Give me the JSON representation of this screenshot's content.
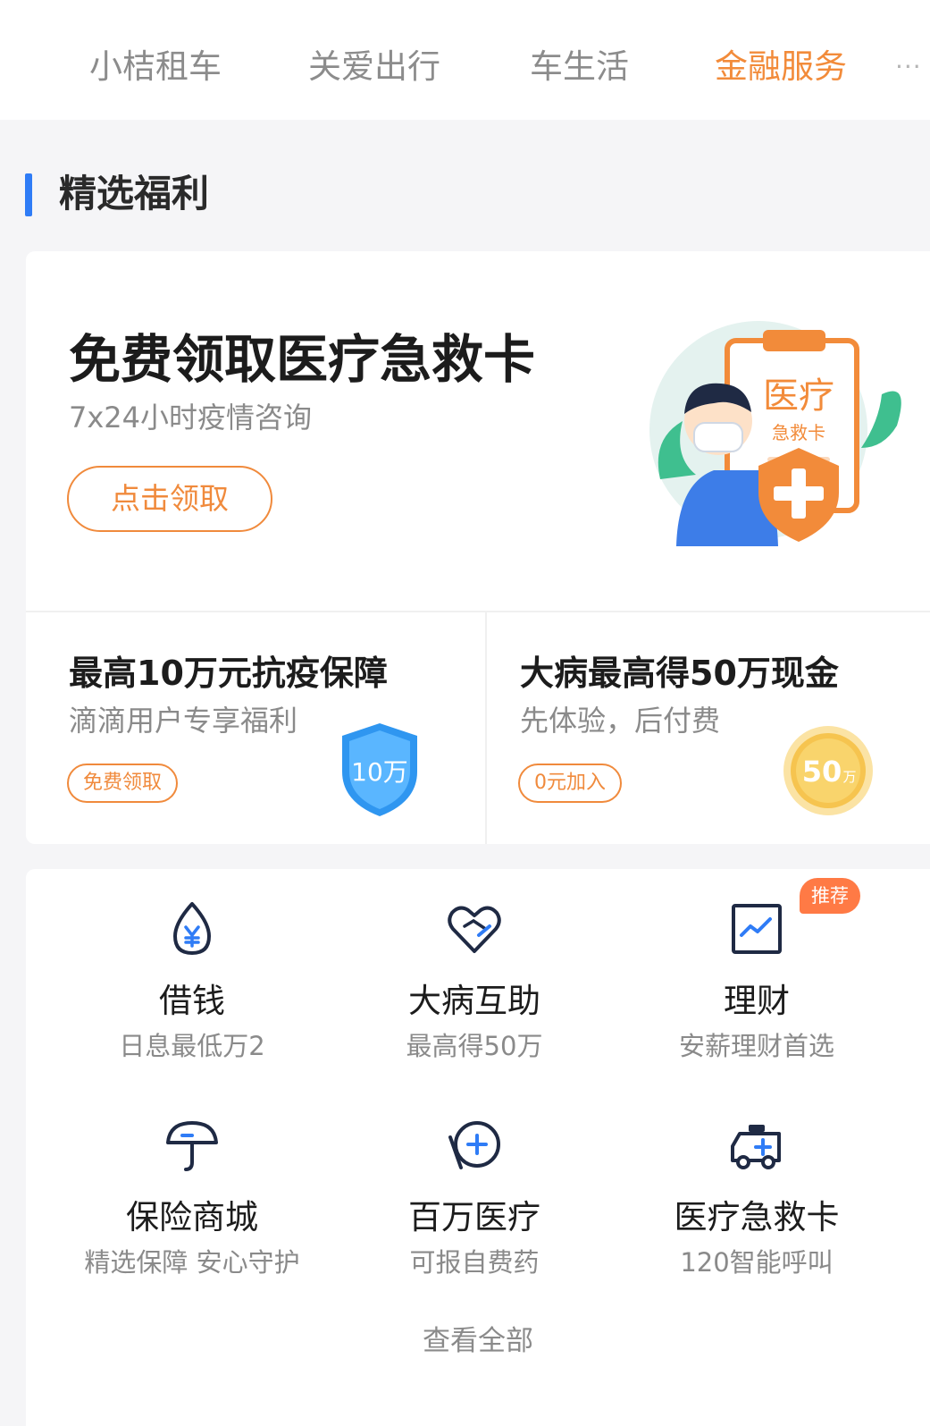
{
  "tabs": [
    {
      "label": "小桔租车",
      "active": false
    },
    {
      "label": "关爱出行",
      "active": false
    },
    {
      "label": "车生活",
      "active": false
    },
    {
      "label": "金融服务",
      "active": true
    }
  ],
  "tabs_more": "···",
  "section": {
    "title": "精选福利"
  },
  "hero": {
    "title": "免费领取医疗急救卡",
    "subtitle": "7x24小时疫情咨询",
    "button": "点击领取",
    "illustration_text_main": "医疗",
    "illustration_text_sub": "急救卡"
  },
  "promos": [
    {
      "title": "最高10万元抗疫保障",
      "subtitle": "滴滴用户专享福利",
      "button": "免费领取",
      "badge": "10万"
    },
    {
      "title": "大病最高得50万现金",
      "subtitle": "先体验，后付费",
      "button": "0元加入",
      "badge_num": "50",
      "badge_unit": "万"
    }
  ],
  "services": [
    {
      "title": "借钱",
      "subtitle": "日息最低万2",
      "icon": "yuan-drop-icon"
    },
    {
      "title": "大病互助",
      "subtitle": "最高得50万",
      "icon": "heart-handshake-icon"
    },
    {
      "title": "理财",
      "subtitle": "安薪理财首选",
      "icon": "chart-up-icon"
    },
    {
      "title": "保险商城",
      "subtitle": "精选保障 安心守护",
      "icon": "umbrella-icon"
    },
    {
      "title": "百万医疗",
      "subtitle": "可报自费药",
      "icon": "medical-shield-icon"
    },
    {
      "title": "医疗急救卡",
      "subtitle": "120智能呼叫",
      "icon": "ambulance-icon"
    }
  ],
  "recommend_badge": "推荐",
  "view_all": "查看全部",
  "colors": {
    "accent": "#f28b3a",
    "section_bar": "#2f7cf6",
    "icon_blue": "#2f7cf6",
    "icon_dark": "#1f2a44"
  }
}
